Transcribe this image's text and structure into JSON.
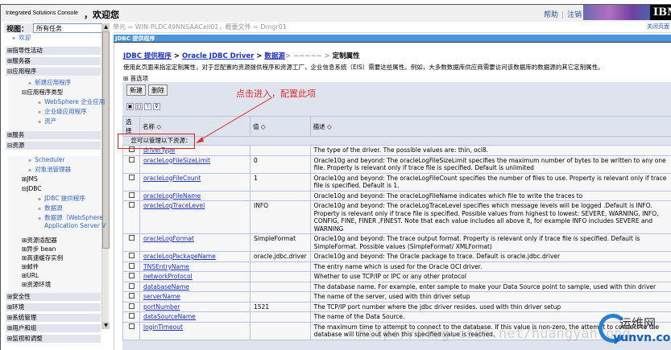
{
  "header": {
    "brand": "Integrated Solutions Console",
    "welcome": "，欢迎您",
    "help": "帮助",
    "logout": "注销",
    "logo": "IBM"
  },
  "sidebar": {
    "view_label": "视图：",
    "view_value": "所有任务",
    "items": [
      {
        "label": "欢迎",
        "type": "link"
      },
      {
        "label": "⊞指导性活动",
        "type": "cat"
      },
      {
        "label": "⊞服务器",
        "type": "cat"
      },
      {
        "label": "⊟应用程序",
        "type": "cat"
      },
      {
        "label": "新建应用程序",
        "type": "link"
      },
      {
        "label": "⊟应用程序类型",
        "type": "sub"
      },
      {
        "label": "WebSphere 企业应用",
        "type": "link"
      },
      {
        "label": "企业级应用程序",
        "type": "link"
      },
      {
        "label": "资产",
        "type": "link"
      },
      {
        "label": "⊞服务",
        "type": "cat"
      },
      {
        "label": "⊟资源",
        "type": "cat"
      },
      {
        "label": "Scheduler",
        "type": "link"
      },
      {
        "label": "对象池管理器",
        "type": "link"
      },
      {
        "label": "⊞JMS",
        "type": "sub"
      },
      {
        "label": "⊟JDBC",
        "type": "sub"
      },
      {
        "label": "JDBC 提供程序",
        "type": "link"
      },
      {
        "label": "数据源",
        "type": "link"
      },
      {
        "label": "数据源（WebSphere",
        "type": "link"
      },
      {
        "label": "Application Server V",
        "type": "link2"
      },
      {
        "label": "⊞资源适配器",
        "type": "sub"
      },
      {
        "label": "⊞异步 bean",
        "type": "sub"
      },
      {
        "label": "⊞高速缓存实例",
        "type": "sub"
      },
      {
        "label": "⊞邮件",
        "type": "sub"
      },
      {
        "label": "⊞URL",
        "type": "sub"
      },
      {
        "label": "⊞资源环境",
        "type": "sub"
      },
      {
        "label": "⊞安全性",
        "type": "cat"
      },
      {
        "label": "⊞环境",
        "type": "cat"
      },
      {
        "label": "⊞系统管理",
        "type": "cat"
      },
      {
        "label": "⊞用户和组",
        "type": "cat"
      },
      {
        "label": "⊞监视和调整",
        "type": "cat"
      }
    ]
  },
  "main": {
    "cell_info": "单元 = WIN-PLDC49NNSAACell01，概要文件 = Dmgr01",
    "close_page": "关闭页面",
    "panel_title": "JDBC 提供程序",
    "breadcrumb": {
      "l1": "JDBC 提供程序",
      "l2": "Oracle JDBC Driver",
      "l3": "数据源",
      "l4": "> ~~~~~ >",
      "current": "定制属性",
      "sep": " > "
    },
    "description": "使用此页面来指定定制属性，对于您配置的资源提供程序和资源工厂，企业信息系统（EIS）需要这些属性。例如，大多数数据库供应商需要访问该数据库的数据源的其它定制属性。",
    "preferences": "⊞ 首选项",
    "buttons": {
      "new": "新建",
      "delete": "删除"
    },
    "table": {
      "headers": {
        "select": "选择",
        "name": "名称 ◇",
        "value": "值 ◇",
        "desc": "描述 ◇"
      },
      "manage_text": "您可以管理以下资源：",
      "rows": [
        {
          "name": "driverType",
          "value": "",
          "desc": "The type of the driver. The possible values are: thin, oci8."
        },
        {
          "name": "oracleLogFileSizeLimit",
          "value": "0",
          "desc": "Oracle10g and beyond: The oracleLogFileSizeLimit specifies the maximum number of bytes to be written to any one file. Property is relevant only if trace file is specified. Default is unlimited"
        },
        {
          "name": "oracleLogFileCount",
          "value": "1",
          "desc": "Oracle10g and beyond: The oracleLogFileCount specifies the number of files to use. Property is relevant only if trace file is specified. Default is 1."
        },
        {
          "name": "oracleLogFileName",
          "value": "",
          "desc": "Oracle10g and beyond: The oracleLogFileName indicates which file to write the traces to"
        },
        {
          "name": "oracleLogTraceLevel",
          "value": "INFO",
          "desc": "Oracle10g and beyond: The oracleLogTraceLevel specifies which message levels will be logged .Default is INFO. Property is relevant only if trace file is specified. Possible values from highest to lowest: SEVERE, WARNING, INFO, CONFIG, FINE, FINER ,FINEST. Note that each value includes all above it, for example INFO includes SEVERE and WARNING"
        },
        {
          "name": "oracleLogFormat",
          "value": "SimpleFormat",
          "desc": "Oracle10g and beyond: The trace output format. Property is relevant only if trace file is specified. Default is SimpleFormat. Possible values (SimpleFormat/ XMLFormat)"
        },
        {
          "name": "oracleLogPackageName",
          "value": "oracle.jdbc.driver",
          "desc": "Oracle10g and beyond: The Oracle package to trace. Default is oracle.jdbc.driver"
        },
        {
          "name": "TNSEntryName",
          "value": "",
          "desc": "The entry name which is used for the Oracle OCI driver."
        },
        {
          "name": "networkProtocol",
          "value": "",
          "desc": "Whether to use TCP/IP or IPC or any other protocol"
        },
        {
          "name": "databaseName",
          "value": "",
          "desc": "The database name. For example, enter sample to make your Data Source point to sample, used with thin driver"
        },
        {
          "name": "serverName",
          "value": "",
          "desc": "The name of the server, used with thin driver setup"
        },
        {
          "name": "portNumber",
          "value": "1521",
          "desc": "The TCP/IP port number where the jdbc driver resides. used with thin driver setup"
        },
        {
          "name": "dataSourceName",
          "value": "",
          "desc": "The name of the Data Source."
        },
        {
          "name": "loginTimeout",
          "value": "",
          "desc": "The maximum time to attempt to connect to the database. If this value is non-zero, the attempt to connect to the database will time out when this specified value is reached."
        }
      ]
    }
  },
  "annotation": "点击进入，配置此项",
  "watermark": {
    "url": "http://blog.csdn.net/huangyanlong",
    "cn": "运维网",
    "en": "yunvn.com"
  }
}
